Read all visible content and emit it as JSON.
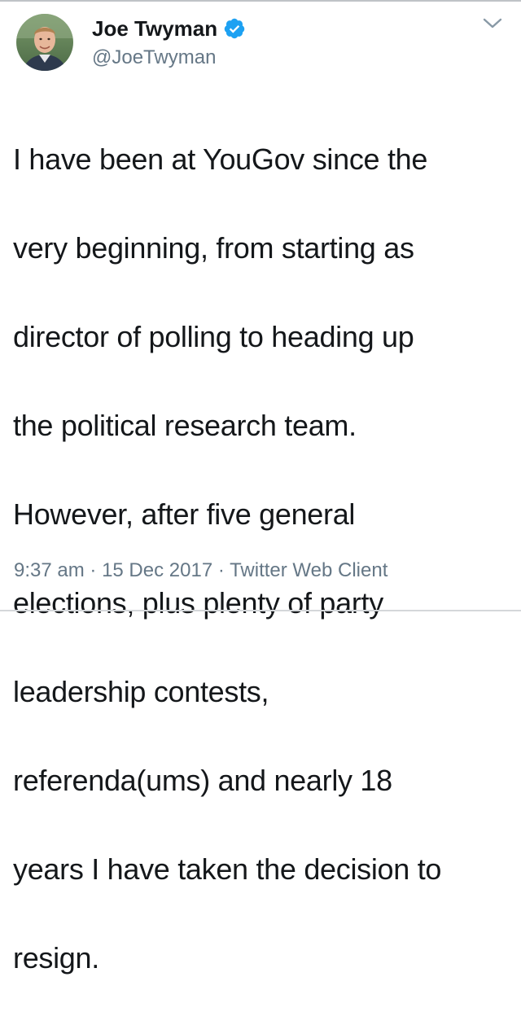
{
  "user": {
    "name": "Joe Twyman",
    "handle": "@JoeTwyman"
  },
  "icons": {
    "verified": "verified-badge-icon",
    "menu": "chevron-down-icon"
  },
  "colors": {
    "verified_blue": "#1da1f2",
    "text": "#14171a",
    "secondary": "#657786"
  },
  "tweet": {
    "text": "I have been at YouGov since the very beginning, from starting as director of polling to heading up the political research team. However, after five general elections, plus plenty of party leadership contests, referenda(ums) and nearly 18 years I have taken the decision to resign.",
    "lines": [
      "I have been at YouGov since the",
      "very beginning, from starting as",
      "director of polling to heading up",
      "the political research team.",
      "However, after five general",
      "elections, plus plenty of party",
      "leadership contests,",
      "referenda(ums) and nearly 18",
      "years I have taken the decision to",
      "resign."
    ]
  },
  "meta": {
    "time": "9:37 am",
    "date": "15 Dec 2017",
    "client": "Twitter Web Client",
    "separator": "·"
  }
}
